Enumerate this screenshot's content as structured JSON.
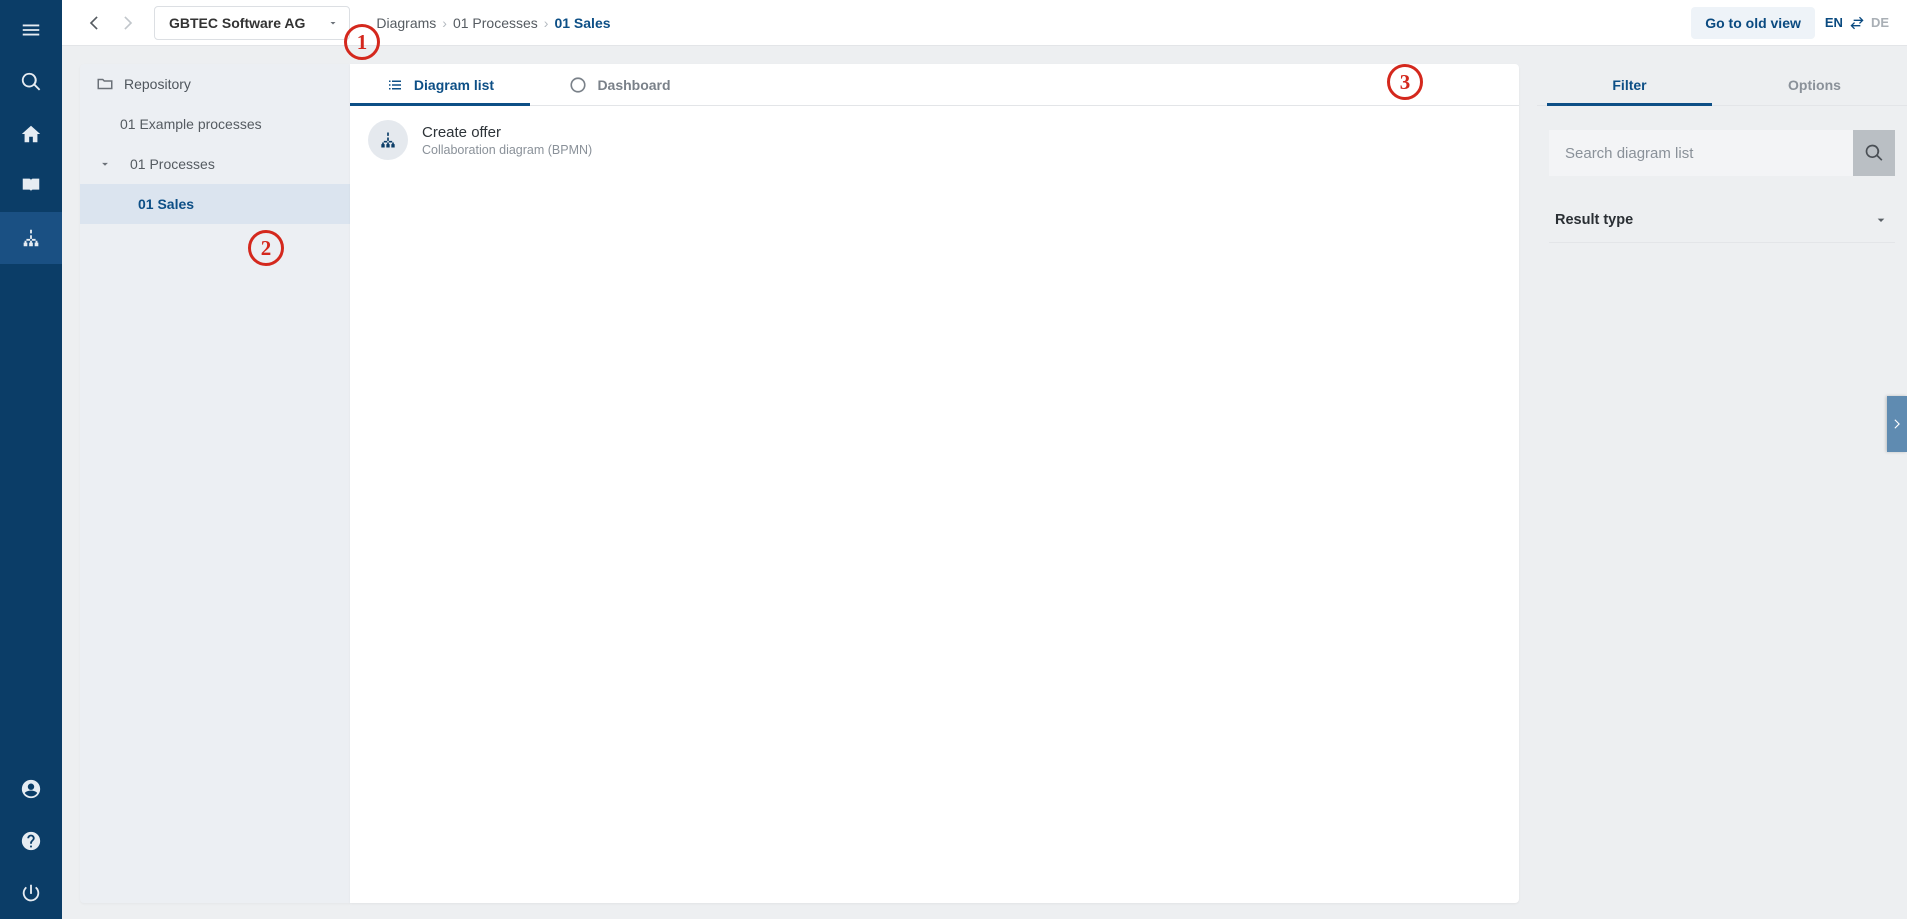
{
  "nav": {
    "items": [
      {
        "name": "menu-icon"
      },
      {
        "name": "search-icon"
      },
      {
        "name": "home-icon"
      },
      {
        "name": "book-icon"
      },
      {
        "name": "hierarchy-icon",
        "active": true
      }
    ],
    "bottom": [
      {
        "name": "user-icon"
      },
      {
        "name": "help-icon"
      },
      {
        "name": "power-icon"
      }
    ]
  },
  "topbar": {
    "workspace": "GBTEC Software AG",
    "breadcrumbs": [
      "Diagrams",
      "01 Processes",
      "01 Sales"
    ],
    "go_old_view": "Go to old view",
    "lang": {
      "en": "EN",
      "de": "DE"
    }
  },
  "tree": {
    "root_label": "Repository",
    "items": [
      {
        "label": "01 Example processes",
        "indent": 1,
        "expand": false
      },
      {
        "label": "01 Processes",
        "indent": 1,
        "expand": true,
        "open": true
      },
      {
        "label": "01 Sales",
        "indent": 2,
        "selected": true
      }
    ]
  },
  "center": {
    "tabs": {
      "list": "Diagram list",
      "dashboard": "Dashboard"
    },
    "items": [
      {
        "title": "Create offer",
        "subtitle": "Collaboration diagram (BPMN)"
      }
    ]
  },
  "filter": {
    "tabs": {
      "filter": "Filter",
      "options": "Options"
    },
    "search_placeholder": "Search diagram list",
    "section_result_type": "Result type"
  },
  "callouts": {
    "1": "1",
    "2": "2",
    "3": "3"
  }
}
